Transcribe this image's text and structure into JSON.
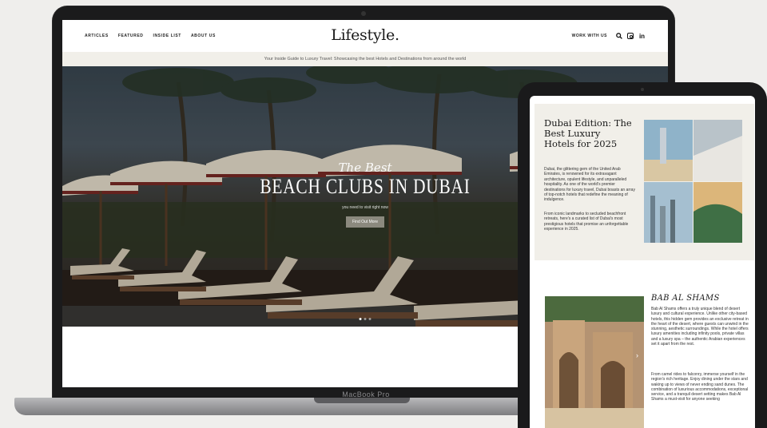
{
  "laptop": {
    "brand": "MacBook Pro",
    "site": {
      "nav": [
        "ARTICLES",
        "FEATURED",
        "INSIDE LIST",
        "ABOUT US"
      ],
      "logo": "Lifestyle.",
      "work_with_us": "WORK WITH US",
      "icons": [
        "search-icon",
        "instagram-icon",
        "linkedin-icon"
      ],
      "linkedin_glyph": "in",
      "tagline": "Your Inside Guide to Luxury Travel: Showcasing the best Hotels and Destinations from around the world",
      "hero": {
        "kicker": "The Best",
        "headline": "BEACH CLUBS IN DUBAI",
        "sub": "you need to visit right now",
        "cta": "Find Out More",
        "slides": 3,
        "active_slide": 1
      }
    }
  },
  "tablet": {
    "article1": {
      "title": "Dubai Edition: The Best Luxury Hotels for 2025",
      "para1": "Dubai, the glittering gem of the United Arab Emirates, is renowned for its extravagant architecture, opulent lifestyle, and unparalleled hospitality. As one of the world's premier destinations for luxury travel, Dubai boasts an array of top-notch hotels that redefine the meaning of indulgence.",
      "para2": "From iconic landmarks to secluded beachfront retreats, here's a curated list of Dubai's most prestigious hotels that promise an unforgettable experience in 2025."
    },
    "article2": {
      "title": "BAB AL SHAMS",
      "para1": "Bab Al Shams offers a truly unique blend of desert luxury and cultural experience. Unlike other city-based hotels, this hidden gem provides an exclusive retreat in the heart of the desert, where guests can unwind in the stunning, aesthetic surroundings. While the hotel offers luxury amenities including infinity pools, private villas and a luxury spa – the authentic Arabian experiences set it apart from the rest.",
      "para2": "From camel rides to falconry, immerse yourself in the region's rich heritage. Enjoy dining under the stars and waking up to views of never ending sand dunes. The combination of luxurious accommodations, exceptional service, and a tranquil desert setting makes Bab Al Shams a must-visit for anyone seeking"
    }
  }
}
